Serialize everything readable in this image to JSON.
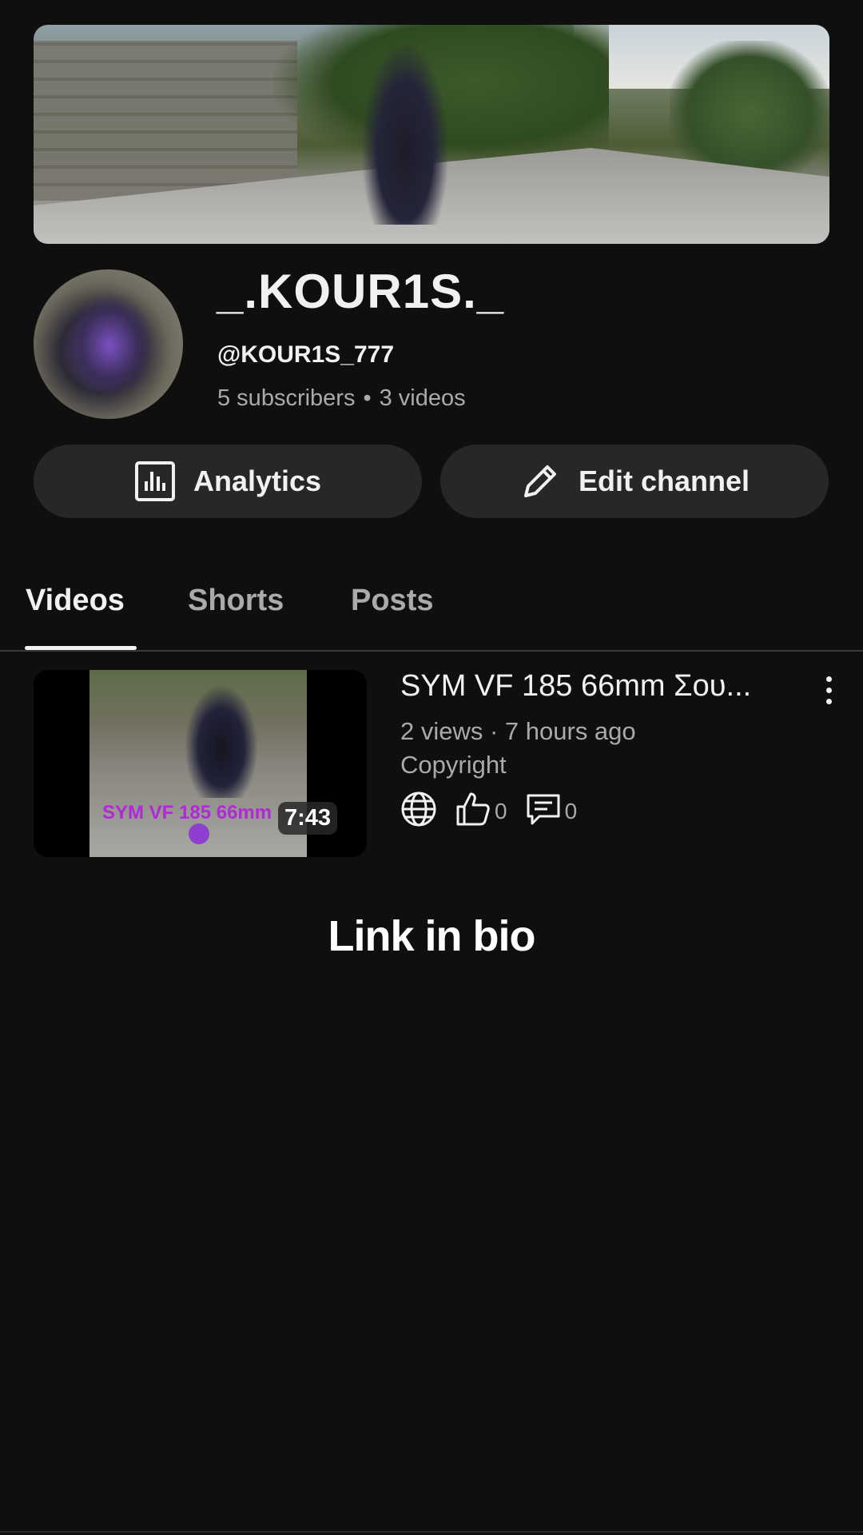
{
  "channel": {
    "name": "_.KOUR1S._",
    "handle": "@KOUR1S_777",
    "subscribers": "5 subscribers",
    "separator": "•",
    "videos": "3 videos"
  },
  "actions": {
    "analytics_label": "Analytics",
    "edit_label": "Edit channel"
  },
  "tabs": [
    {
      "label": "Videos",
      "active": true
    },
    {
      "label": "Shorts",
      "active": false
    },
    {
      "label": "Posts",
      "active": false
    }
  ],
  "videos": [
    {
      "title": "SYM VF 185 66mm Σου...",
      "meta": "2 views · 7 hours ago",
      "license": "Copyright",
      "duration": "7:43",
      "thumbnail_caption": "SYM VF 185 66mm",
      "likes": "0",
      "comments": "0",
      "visibility_icon": "globe-icon"
    }
  ],
  "overlay_text": "Link in bio",
  "colors": {
    "background": "#0f0f0f",
    "button": "#272727",
    "secondary_text": "#aaaaaa",
    "thumbnail_caption": "#b129d6"
  }
}
